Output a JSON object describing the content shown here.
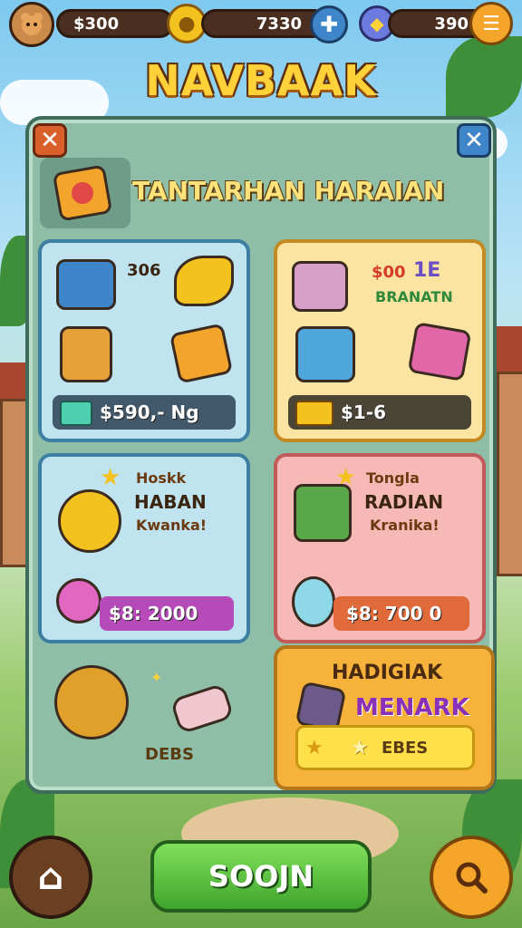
{
  "header": {
    "currency1": "$300",
    "currency2": "7330",
    "currency3": "390"
  },
  "title": "NAVBAAK",
  "section": {
    "title": "TANTARHAN HARAIAN"
  },
  "cards": {
    "c1": {
      "tag": "306",
      "price": "$590,- Ng"
    },
    "c2": {
      "tag1": "$00",
      "tag2": "1E",
      "label": "BRANATN",
      "price": "$1-6"
    },
    "c3": {
      "l1": "Hoskk",
      "l2": "HABAN",
      "l3": "Kwanka!",
      "price": "$8: 2000"
    },
    "c4": {
      "l1": "Tongla",
      "l2": "RADIAN",
      "l3": "Kranika!",
      "price": "$8: 700 0"
    },
    "c5": {
      "label": "DEBS"
    },
    "c6": {
      "l1": "HADIGIAK",
      "l2": "MENARK",
      "btn": "EBES"
    }
  },
  "bottom": {
    "main_button": "SOOJN"
  },
  "colors": {
    "accent": "#ffd23a",
    "panel": "#8fbea8",
    "button": "#3fa52d"
  }
}
